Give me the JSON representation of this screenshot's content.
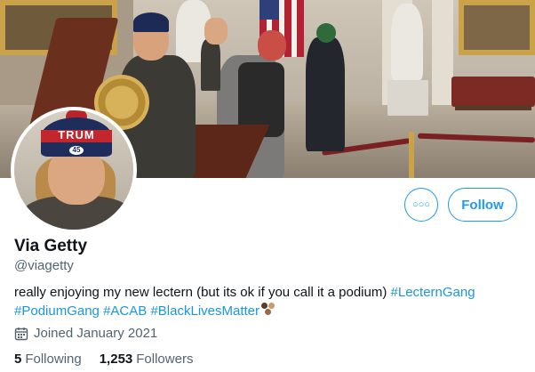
{
  "profile": {
    "display_name": "Via Getty",
    "handle": "@viagetty",
    "bio": {
      "text": "really enjoying my new lectern (but its ok if you call it a podium) ",
      "hashtags": [
        "#LecternGang",
        "#PodiumGang",
        "#ACAB",
        "#BlackLivesMatter"
      ]
    },
    "joined": "Joined January 2021",
    "following": {
      "count": "5",
      "label": "Following"
    },
    "followers": {
      "count": "1,253",
      "label": "Followers"
    }
  },
  "avatar": {
    "hat_text": "TRUM",
    "badge_text": "45"
  },
  "actions": {
    "more_icon": "more-options-icon",
    "follow_label": "Follow"
  },
  "colors": {
    "accent": "#1d9bf0",
    "hashtag": "#1b95e0",
    "secondary_text": "#536471",
    "primary_text": "#0f1419"
  },
  "icons": {
    "calendar": "calendar-icon",
    "bio_emoji": "hand-emoji"
  }
}
